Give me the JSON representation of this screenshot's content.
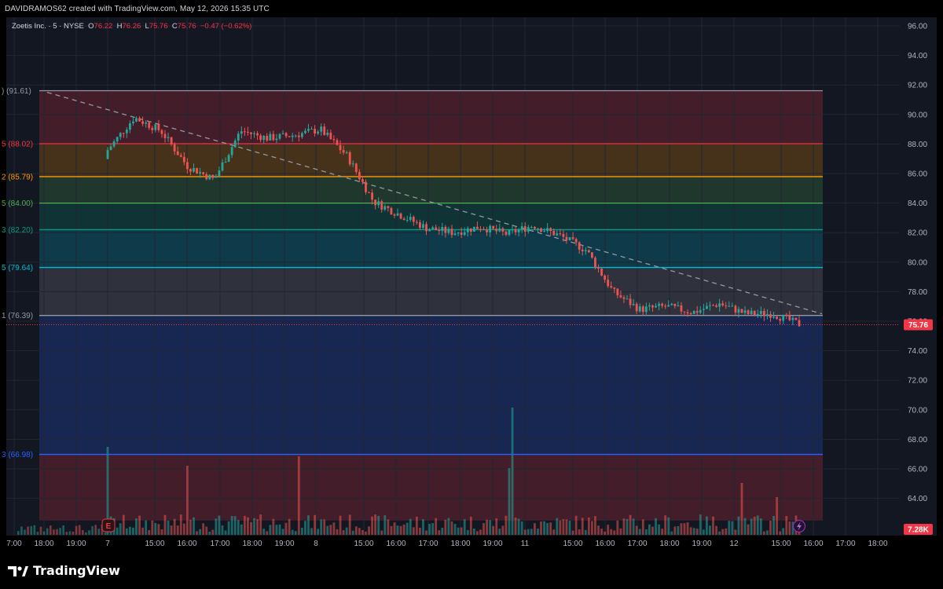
{
  "header": {
    "credit": "DAVIDRAMOS62 created with TradingView.com, May 12, 2026 15:35 UTC"
  },
  "legend": {
    "symbol": "Zoetis Inc. · 5 · NYSE",
    "o_label": "O",
    "o_value": "76.22",
    "h_label": "H",
    "h_value": "76.26",
    "l_label": "L",
    "l_value": "75.76",
    "c_label": "C",
    "c_value": "75.76",
    "change": "−0.47 (−0.62%)"
  },
  "footer": {
    "brand": "TradingView"
  },
  "colors": {
    "up": "#26a69a",
    "down": "#ef5350",
    "pane": "#131722",
    "grid": "#222632"
  },
  "chart_data": {
    "type": "candlestick",
    "ylim": [
      62.5,
      96.5
    ],
    "y_ticks": [
      "96.00",
      "94.00",
      "92.00",
      "90.00",
      "88.00",
      "86.00",
      "84.00",
      "82.00",
      "80.00",
      "78.00",
      "76.00",
      "74.00",
      "72.00",
      "70.00",
      "68.00",
      "66.00",
      "64.00"
    ],
    "x_ticks": [
      "7:00",
      "18:00",
      "19:00",
      "7",
      "15:00",
      "16:00",
      "17:00",
      "18:00",
      "19:00",
      "8",
      "15:00",
      "16:00",
      "17:00",
      "18:00",
      "19:00",
      "11",
      "15:00",
      "16:00",
      "17:00",
      "18:00",
      "19:00",
      "12",
      "15:00",
      "16:00",
      "17:00",
      "18:00"
    ],
    "last_price": "75.76",
    "volume_label": "7.28K",
    "events": [
      "E"
    ],
    "fib_levels": [
      {
        "label": ") (91.61)",
        "value": 91.61,
        "color": "#9598a1"
      },
      {
        "label": "5 (88.02)",
        "value": 88.02,
        "color": "#f23645"
      },
      {
        "label": "2 (85.79)",
        "value": 85.79,
        "color": "#ff9800"
      },
      {
        "label": "5 (84.00)",
        "value": 84.0,
        "color": "#4caf50"
      },
      {
        "label": "3 (82.20)",
        "value": 82.2,
        "color": "#089981"
      },
      {
        "label": "5 (79.64)",
        "value": 79.64,
        "color": "#00bcd4"
      },
      {
        "label": "1 (76.39)",
        "value": 76.39,
        "color": "#9598a1"
      },
      {
        "label": "3 (66.98)",
        "value": 66.98,
        "color": "#2962ff"
      }
    ],
    "fib_zones": [
      {
        "from": 91.61,
        "to": 88.02,
        "color": "#f23645"
      },
      {
        "from": 88.02,
        "to": 85.79,
        "color": "#ff9800"
      },
      {
        "from": 85.79,
        "to": 84.0,
        "color": "#4caf50"
      },
      {
        "from": 84.0,
        "to": 82.2,
        "color": "#089981"
      },
      {
        "from": 82.2,
        "to": 79.64,
        "color": "#00bcd4"
      },
      {
        "from": 79.64,
        "to": 76.39,
        "color": "#9598a1"
      },
      {
        "from": 76.39,
        "to": 66.98,
        "color": "#2962ff"
      },
      {
        "from": 66.98,
        "to": 62.5,
        "color": "#f23645"
      }
    ],
    "trendline": {
      "start": 91.5,
      "end": 76.5
    },
    "price_path": [
      87.6,
      89.8,
      88.9,
      86.5,
      85.6,
      88.9,
      88.4,
      88.6,
      89.0,
      87.2,
      84.1,
      83.2,
      82.3,
      82.0,
      82.4,
      81.9,
      82.5,
      81.8,
      80.8,
      78.0,
      76.8,
      77.0,
      76.6,
      77.2,
      76.5,
      76.5,
      75.8
    ]
  }
}
